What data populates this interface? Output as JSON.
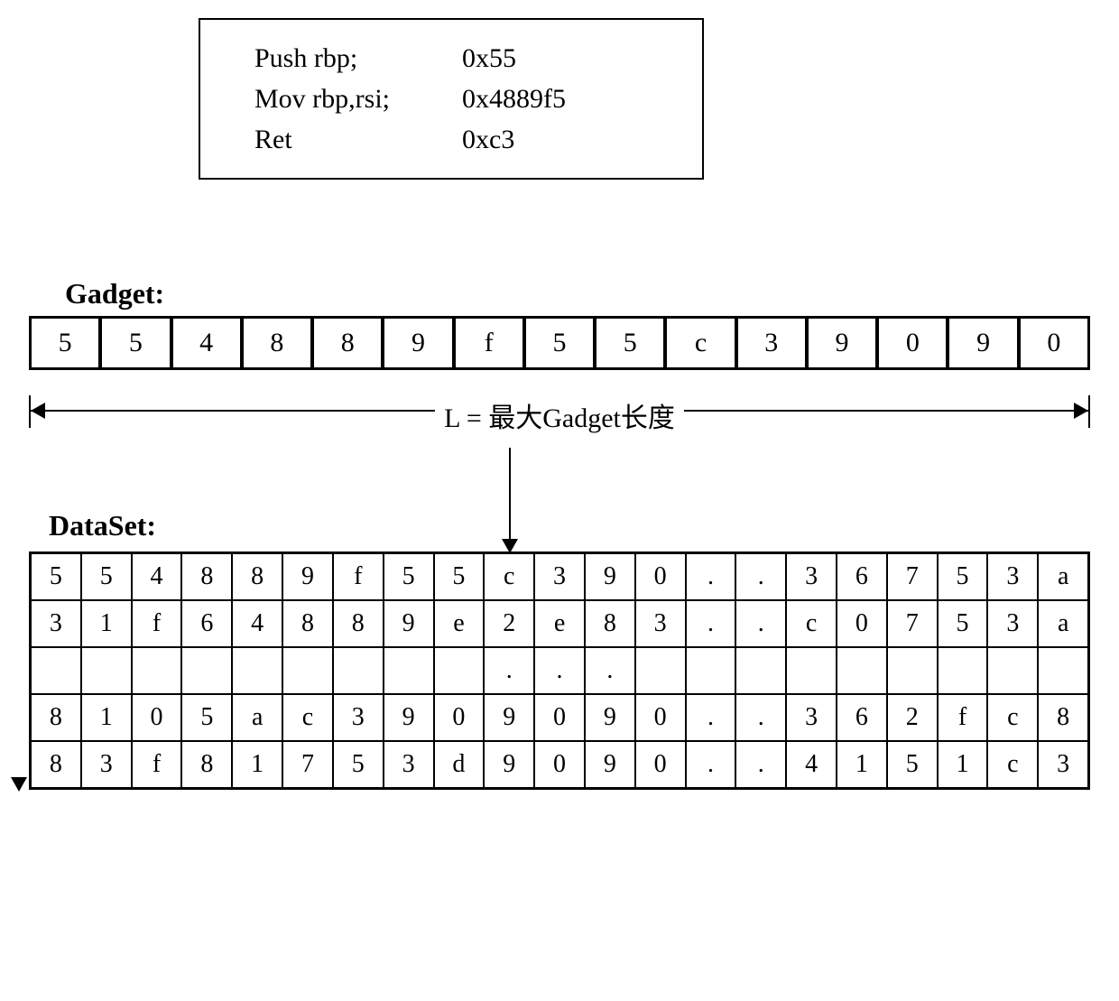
{
  "code": {
    "lines": [
      {
        "asm": "Push rbp;",
        "hex": "0x55"
      },
      {
        "asm": "Mov rbp,rsi;",
        "hex": "0x4889f5"
      },
      {
        "asm": "Ret",
        "hex": " 0xc3"
      }
    ]
  },
  "labels": {
    "gadget": "Gadget:",
    "dataset": "DataSet:",
    "dimension": "L = 最大Gadget长度"
  },
  "gadget_cells": [
    "5",
    "5",
    "4",
    "8",
    "8",
    "9",
    "f",
    "5",
    "5",
    "c",
    "3",
    "9",
    "0",
    "9",
    "0"
  ],
  "dataset_rows": [
    [
      "5",
      "5",
      "4",
      "8",
      "8",
      "9",
      "f",
      "5",
      "5",
      "c",
      "3",
      "9",
      "0",
      ".",
      ".",
      "3",
      "6",
      "7",
      "5",
      "3",
      "a"
    ],
    [
      "3",
      "1",
      "f",
      "6",
      "4",
      "8",
      "8",
      "9",
      "e",
      "2",
      "e",
      "8",
      "3",
      ".",
      ".",
      "c",
      "0",
      "7",
      "5",
      "3",
      "a"
    ],
    [
      "",
      "",
      "",
      "",
      "",
      "",
      "",
      "",
      "",
      ".",
      ".",
      ".",
      "",
      "",
      "",
      "",
      "",
      "",
      "",
      "",
      ""
    ],
    [
      "8",
      "1",
      "0",
      "5",
      "a",
      "c",
      "3",
      "9",
      "0",
      "9",
      "0",
      "9",
      "0",
      ".",
      ".",
      "3",
      "6",
      "2",
      "f",
      "c",
      "8"
    ],
    [
      "8",
      "3",
      "f",
      "8",
      "1",
      "7",
      "5",
      "3",
      "d",
      "9",
      "0",
      "9",
      "0",
      ".",
      ".",
      "4",
      "1",
      "5",
      "1",
      "c",
      "3"
    ]
  ]
}
